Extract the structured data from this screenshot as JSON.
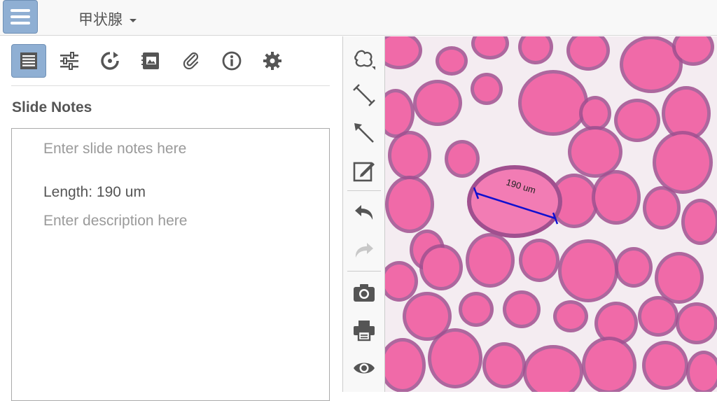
{
  "header": {
    "menu_icon": "hamburger-menu-icon",
    "title": "甲状腺"
  },
  "left_toolbar": [
    {
      "icon": "notes-icon",
      "active": true
    },
    {
      "icon": "sliders-icon",
      "active": false
    },
    {
      "icon": "refresh-icon",
      "active": false
    },
    {
      "icon": "image-notebook-icon",
      "active": false
    },
    {
      "icon": "paperclip-icon",
      "active": false
    },
    {
      "icon": "info-icon",
      "active": false
    },
    {
      "icon": "gear-icon",
      "active": false
    }
  ],
  "notes": {
    "section_title": "Slide Notes",
    "slide_notes_placeholder": "Enter slide notes here",
    "measurement_text": "Length: 190 um",
    "description_placeholder": "Enter description here"
  },
  "right_toolbar": [
    "freehand-polygon-icon",
    "line-measure-icon",
    "arrow-icon",
    "edit-note-icon",
    "undo-icon",
    "redo-icon",
    "camera-icon",
    "print-icon",
    "eye-icon"
  ],
  "slide_annotation": {
    "label": "190 um",
    "line_color": "#1010d0"
  },
  "colors": {
    "accent": "#8fafd3",
    "tissue_pink": "#f06aa8",
    "tissue_purple": "#a0508f"
  }
}
